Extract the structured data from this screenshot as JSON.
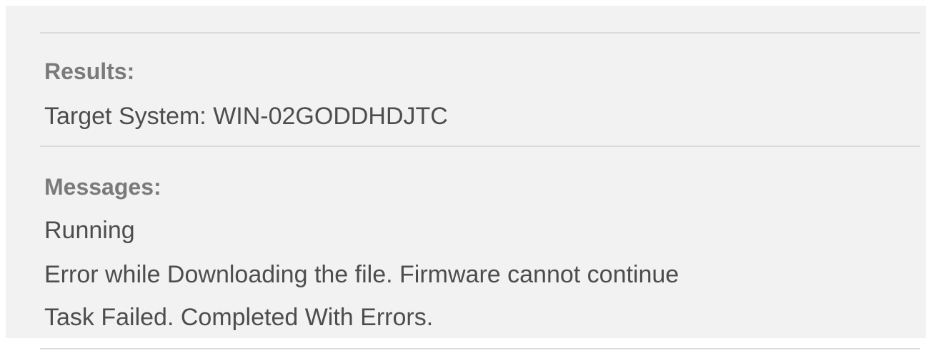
{
  "results": {
    "heading": "Results:",
    "target_system_line": "Target System: WIN-02GODDHDJTC"
  },
  "messages": {
    "heading": "Messages:",
    "items": [
      "Running",
      "Error while Downloading the file. Firmware cannot continue",
      "Task Failed. Completed With Errors."
    ]
  },
  "colors": {
    "panel_background": "#f2f2f2",
    "heading_text": "#7a7a7a",
    "body_text": "#4d4d4d",
    "divider": "#dcdcdc"
  }
}
